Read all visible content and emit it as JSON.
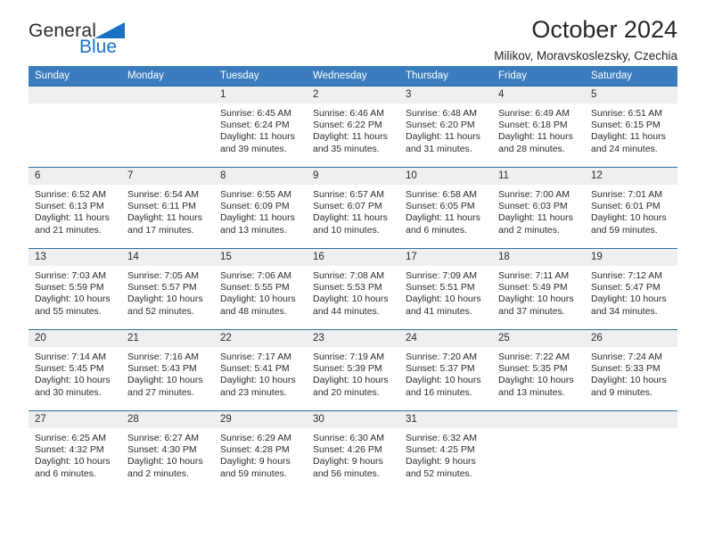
{
  "brand": {
    "name_top": "General",
    "name_bottom": "Blue",
    "triangle_icon": "triangle-icon",
    "color_top": "#2b2b2b",
    "color_bottom": "#1a71c4"
  },
  "header": {
    "title": "October 2024",
    "subtitle": "Milikov, Moravskoslezsky, Czechia"
  },
  "colors": {
    "header_row_bg": "#3a7cbe",
    "header_row_text": "#ffffff",
    "daynum_bg": "#efefef",
    "cell_border": "#2e6da4"
  },
  "calendar": {
    "weekdays": [
      "Sunday",
      "Monday",
      "Tuesday",
      "Wednesday",
      "Thursday",
      "Friday",
      "Saturday"
    ],
    "labels": {
      "sunrise": "Sunrise:",
      "sunset": "Sunset:",
      "daylight": "Daylight:"
    },
    "weeks": [
      [
        {
          "day": ""
        },
        {
          "day": ""
        },
        {
          "day": "1",
          "sunrise": "Sunrise: 6:45 AM",
          "sunset": "Sunset: 6:24 PM",
          "daylight_1": "Daylight: 11 hours",
          "daylight_2": "and 39 minutes."
        },
        {
          "day": "2",
          "sunrise": "Sunrise: 6:46 AM",
          "sunset": "Sunset: 6:22 PM",
          "daylight_1": "Daylight: 11 hours",
          "daylight_2": "and 35 minutes."
        },
        {
          "day": "3",
          "sunrise": "Sunrise: 6:48 AM",
          "sunset": "Sunset: 6:20 PM",
          "daylight_1": "Daylight: 11 hours",
          "daylight_2": "and 31 minutes."
        },
        {
          "day": "4",
          "sunrise": "Sunrise: 6:49 AM",
          "sunset": "Sunset: 6:18 PM",
          "daylight_1": "Daylight: 11 hours",
          "daylight_2": "and 28 minutes."
        },
        {
          "day": "5",
          "sunrise": "Sunrise: 6:51 AM",
          "sunset": "Sunset: 6:15 PM",
          "daylight_1": "Daylight: 11 hours",
          "daylight_2": "and 24 minutes."
        }
      ],
      [
        {
          "day": "6",
          "sunrise": "Sunrise: 6:52 AM",
          "sunset": "Sunset: 6:13 PM",
          "daylight_1": "Daylight: 11 hours",
          "daylight_2": "and 21 minutes."
        },
        {
          "day": "7",
          "sunrise": "Sunrise: 6:54 AM",
          "sunset": "Sunset: 6:11 PM",
          "daylight_1": "Daylight: 11 hours",
          "daylight_2": "and 17 minutes."
        },
        {
          "day": "8",
          "sunrise": "Sunrise: 6:55 AM",
          "sunset": "Sunset: 6:09 PM",
          "daylight_1": "Daylight: 11 hours",
          "daylight_2": "and 13 minutes."
        },
        {
          "day": "9",
          "sunrise": "Sunrise: 6:57 AM",
          "sunset": "Sunset: 6:07 PM",
          "daylight_1": "Daylight: 11 hours",
          "daylight_2": "and 10 minutes."
        },
        {
          "day": "10",
          "sunrise": "Sunrise: 6:58 AM",
          "sunset": "Sunset: 6:05 PM",
          "daylight_1": "Daylight: 11 hours",
          "daylight_2": "and 6 minutes."
        },
        {
          "day": "11",
          "sunrise": "Sunrise: 7:00 AM",
          "sunset": "Sunset: 6:03 PM",
          "daylight_1": "Daylight: 11 hours",
          "daylight_2": "and 2 minutes."
        },
        {
          "day": "12",
          "sunrise": "Sunrise: 7:01 AM",
          "sunset": "Sunset: 6:01 PM",
          "daylight_1": "Daylight: 10 hours",
          "daylight_2": "and 59 minutes."
        }
      ],
      [
        {
          "day": "13",
          "sunrise": "Sunrise: 7:03 AM",
          "sunset": "Sunset: 5:59 PM",
          "daylight_1": "Daylight: 10 hours",
          "daylight_2": "and 55 minutes."
        },
        {
          "day": "14",
          "sunrise": "Sunrise: 7:05 AM",
          "sunset": "Sunset: 5:57 PM",
          "daylight_1": "Daylight: 10 hours",
          "daylight_2": "and 52 minutes."
        },
        {
          "day": "15",
          "sunrise": "Sunrise: 7:06 AM",
          "sunset": "Sunset: 5:55 PM",
          "daylight_1": "Daylight: 10 hours",
          "daylight_2": "and 48 minutes."
        },
        {
          "day": "16",
          "sunrise": "Sunrise: 7:08 AM",
          "sunset": "Sunset: 5:53 PM",
          "daylight_1": "Daylight: 10 hours",
          "daylight_2": "and 44 minutes."
        },
        {
          "day": "17",
          "sunrise": "Sunrise: 7:09 AM",
          "sunset": "Sunset: 5:51 PM",
          "daylight_1": "Daylight: 10 hours",
          "daylight_2": "and 41 minutes."
        },
        {
          "day": "18",
          "sunrise": "Sunrise: 7:11 AM",
          "sunset": "Sunset: 5:49 PM",
          "daylight_1": "Daylight: 10 hours",
          "daylight_2": "and 37 minutes."
        },
        {
          "day": "19",
          "sunrise": "Sunrise: 7:12 AM",
          "sunset": "Sunset: 5:47 PM",
          "daylight_1": "Daylight: 10 hours",
          "daylight_2": "and 34 minutes."
        }
      ],
      [
        {
          "day": "20",
          "sunrise": "Sunrise: 7:14 AM",
          "sunset": "Sunset: 5:45 PM",
          "daylight_1": "Daylight: 10 hours",
          "daylight_2": "and 30 minutes."
        },
        {
          "day": "21",
          "sunrise": "Sunrise: 7:16 AM",
          "sunset": "Sunset: 5:43 PM",
          "daylight_1": "Daylight: 10 hours",
          "daylight_2": "and 27 minutes."
        },
        {
          "day": "22",
          "sunrise": "Sunrise: 7:17 AM",
          "sunset": "Sunset: 5:41 PM",
          "daylight_1": "Daylight: 10 hours",
          "daylight_2": "and 23 minutes."
        },
        {
          "day": "23",
          "sunrise": "Sunrise: 7:19 AM",
          "sunset": "Sunset: 5:39 PM",
          "daylight_1": "Daylight: 10 hours",
          "daylight_2": "and 20 minutes."
        },
        {
          "day": "24",
          "sunrise": "Sunrise: 7:20 AM",
          "sunset": "Sunset: 5:37 PM",
          "daylight_1": "Daylight: 10 hours",
          "daylight_2": "and 16 minutes."
        },
        {
          "day": "25",
          "sunrise": "Sunrise: 7:22 AM",
          "sunset": "Sunset: 5:35 PM",
          "daylight_1": "Daylight: 10 hours",
          "daylight_2": "and 13 minutes."
        },
        {
          "day": "26",
          "sunrise": "Sunrise: 7:24 AM",
          "sunset": "Sunset: 5:33 PM",
          "daylight_1": "Daylight: 10 hours",
          "daylight_2": "and 9 minutes."
        }
      ],
      [
        {
          "day": "27",
          "sunrise": "Sunrise: 6:25 AM",
          "sunset": "Sunset: 4:32 PM",
          "daylight_1": "Daylight: 10 hours",
          "daylight_2": "and 6 minutes."
        },
        {
          "day": "28",
          "sunrise": "Sunrise: 6:27 AM",
          "sunset": "Sunset: 4:30 PM",
          "daylight_1": "Daylight: 10 hours",
          "daylight_2": "and 2 minutes."
        },
        {
          "day": "29",
          "sunrise": "Sunrise: 6:29 AM",
          "sunset": "Sunset: 4:28 PM",
          "daylight_1": "Daylight: 9 hours",
          "daylight_2": "and 59 minutes."
        },
        {
          "day": "30",
          "sunrise": "Sunrise: 6:30 AM",
          "sunset": "Sunset: 4:26 PM",
          "daylight_1": "Daylight: 9 hours",
          "daylight_2": "and 56 minutes."
        },
        {
          "day": "31",
          "sunrise": "Sunrise: 6:32 AM",
          "sunset": "Sunset: 4:25 PM",
          "daylight_1": "Daylight: 9 hours",
          "daylight_2": "and 52 minutes."
        },
        {
          "day": ""
        },
        {
          "day": ""
        }
      ]
    ]
  }
}
